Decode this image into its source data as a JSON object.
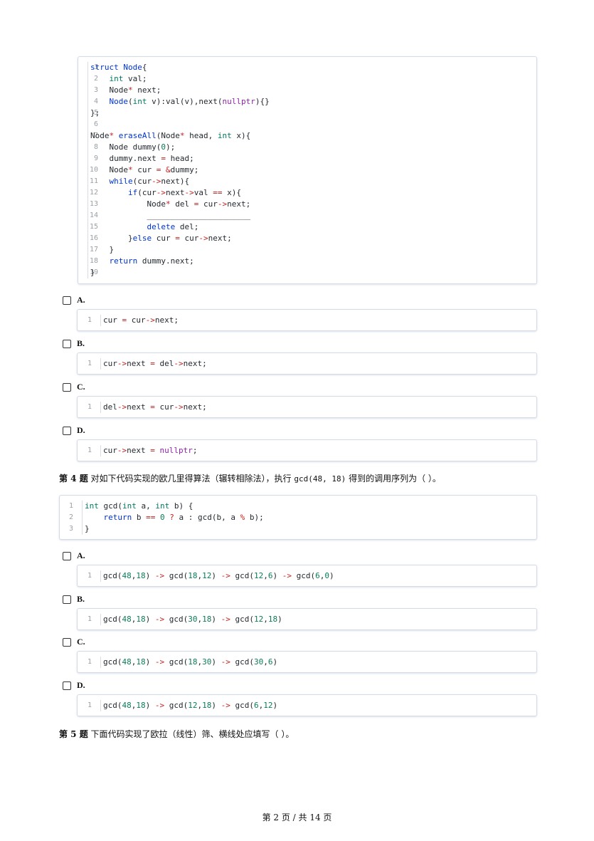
{
  "q3_code": [
    "struct Node{",
    "    int val;",
    "    Node* next;",
    "    Node(int v):val(v),next(nullptr){}",
    "};",
    "",
    "Node* eraseAll(Node* head, int x){",
    "    Node dummy(0);",
    "    dummy.next = head;",
    "    Node* cur = &dummy;",
    "    while(cur->next){",
    "        if(cur->next->val == x){",
    "            Node* del = cur->next;",
    "            ______________________",
    "            delete del;",
    "        }else cur = cur->next;",
    "    }",
    "    return dummy.next;",
    "}"
  ],
  "q3_options": [
    {
      "label": "A.",
      "code": "cur = cur->next;"
    },
    {
      "label": "B.",
      "code": "cur->next = del->next;"
    },
    {
      "label": "C.",
      "code": "del->next = cur->next;"
    },
    {
      "label": "D.",
      "code": "cur->next = nullptr;"
    }
  ],
  "q4": {
    "number": "第 4 题",
    "text_before": "对如下代码实现的欧几里得算法（辗转相除法），执行",
    "code_inline": "gcd(48, 18)",
    "text_after": "得到的调用序列为（ ）。"
  },
  "q4_code": [
    "int gcd(int a, int b) {",
    "    return b == 0 ? a : gcd(b, a % b);",
    "}"
  ],
  "q4_options": [
    {
      "label": "A.",
      "code": "gcd(48,18) -> gcd(18,12) -> gcd(12,6) -> gcd(6,0)"
    },
    {
      "label": "B.",
      "code": "gcd(48,18) -> gcd(30,18) -> gcd(12,18)"
    },
    {
      "label": "C.",
      "code": "gcd(48,18) -> gcd(18,30) -> gcd(30,6)"
    },
    {
      "label": "D.",
      "code": "gcd(48,18) -> gcd(12,18) -> gcd(6,12)"
    }
  ],
  "q5": {
    "number": "第 5 题",
    "text": "下面代码实现了欧拉（线性）筛、横线处应填写（ ）。"
  },
  "footer": "第 2 页 / 共 14 页"
}
